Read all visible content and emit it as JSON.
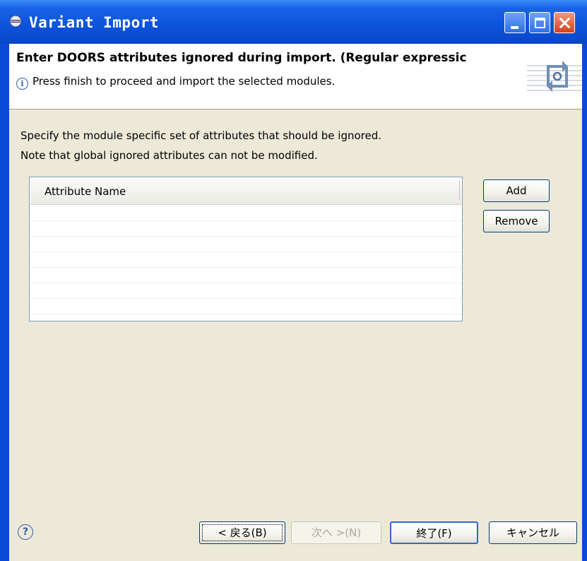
{
  "window": {
    "title": "Variant Import",
    "controls": [
      "minimize",
      "maximize",
      "close"
    ]
  },
  "header": {
    "title": "Enter DOORS attributes ignored during import. (Regular expressic",
    "message": "Press finish to proceed and import the selected modules.",
    "message_icon": "info-icon"
  },
  "body": {
    "description_line1": "Specify the module specific set of attributes that should be ignored.",
    "description_line2": "Note that global ignored attributes can not be modified."
  },
  "table": {
    "columns": [
      "Attribute Name"
    ],
    "rows": []
  },
  "side_buttons": {
    "add": "Add",
    "remove": "Remove"
  },
  "footer": {
    "help_icon": "help-icon",
    "back": "< 戻る(B)",
    "next": "次へ >(N)",
    "finish": "終了(F)",
    "cancel": "キャンセル",
    "next_enabled": false
  },
  "colors": {
    "titlebar": "#0b4bd0",
    "dialog_background": "#ece9d8",
    "button_border": "#003c74"
  }
}
